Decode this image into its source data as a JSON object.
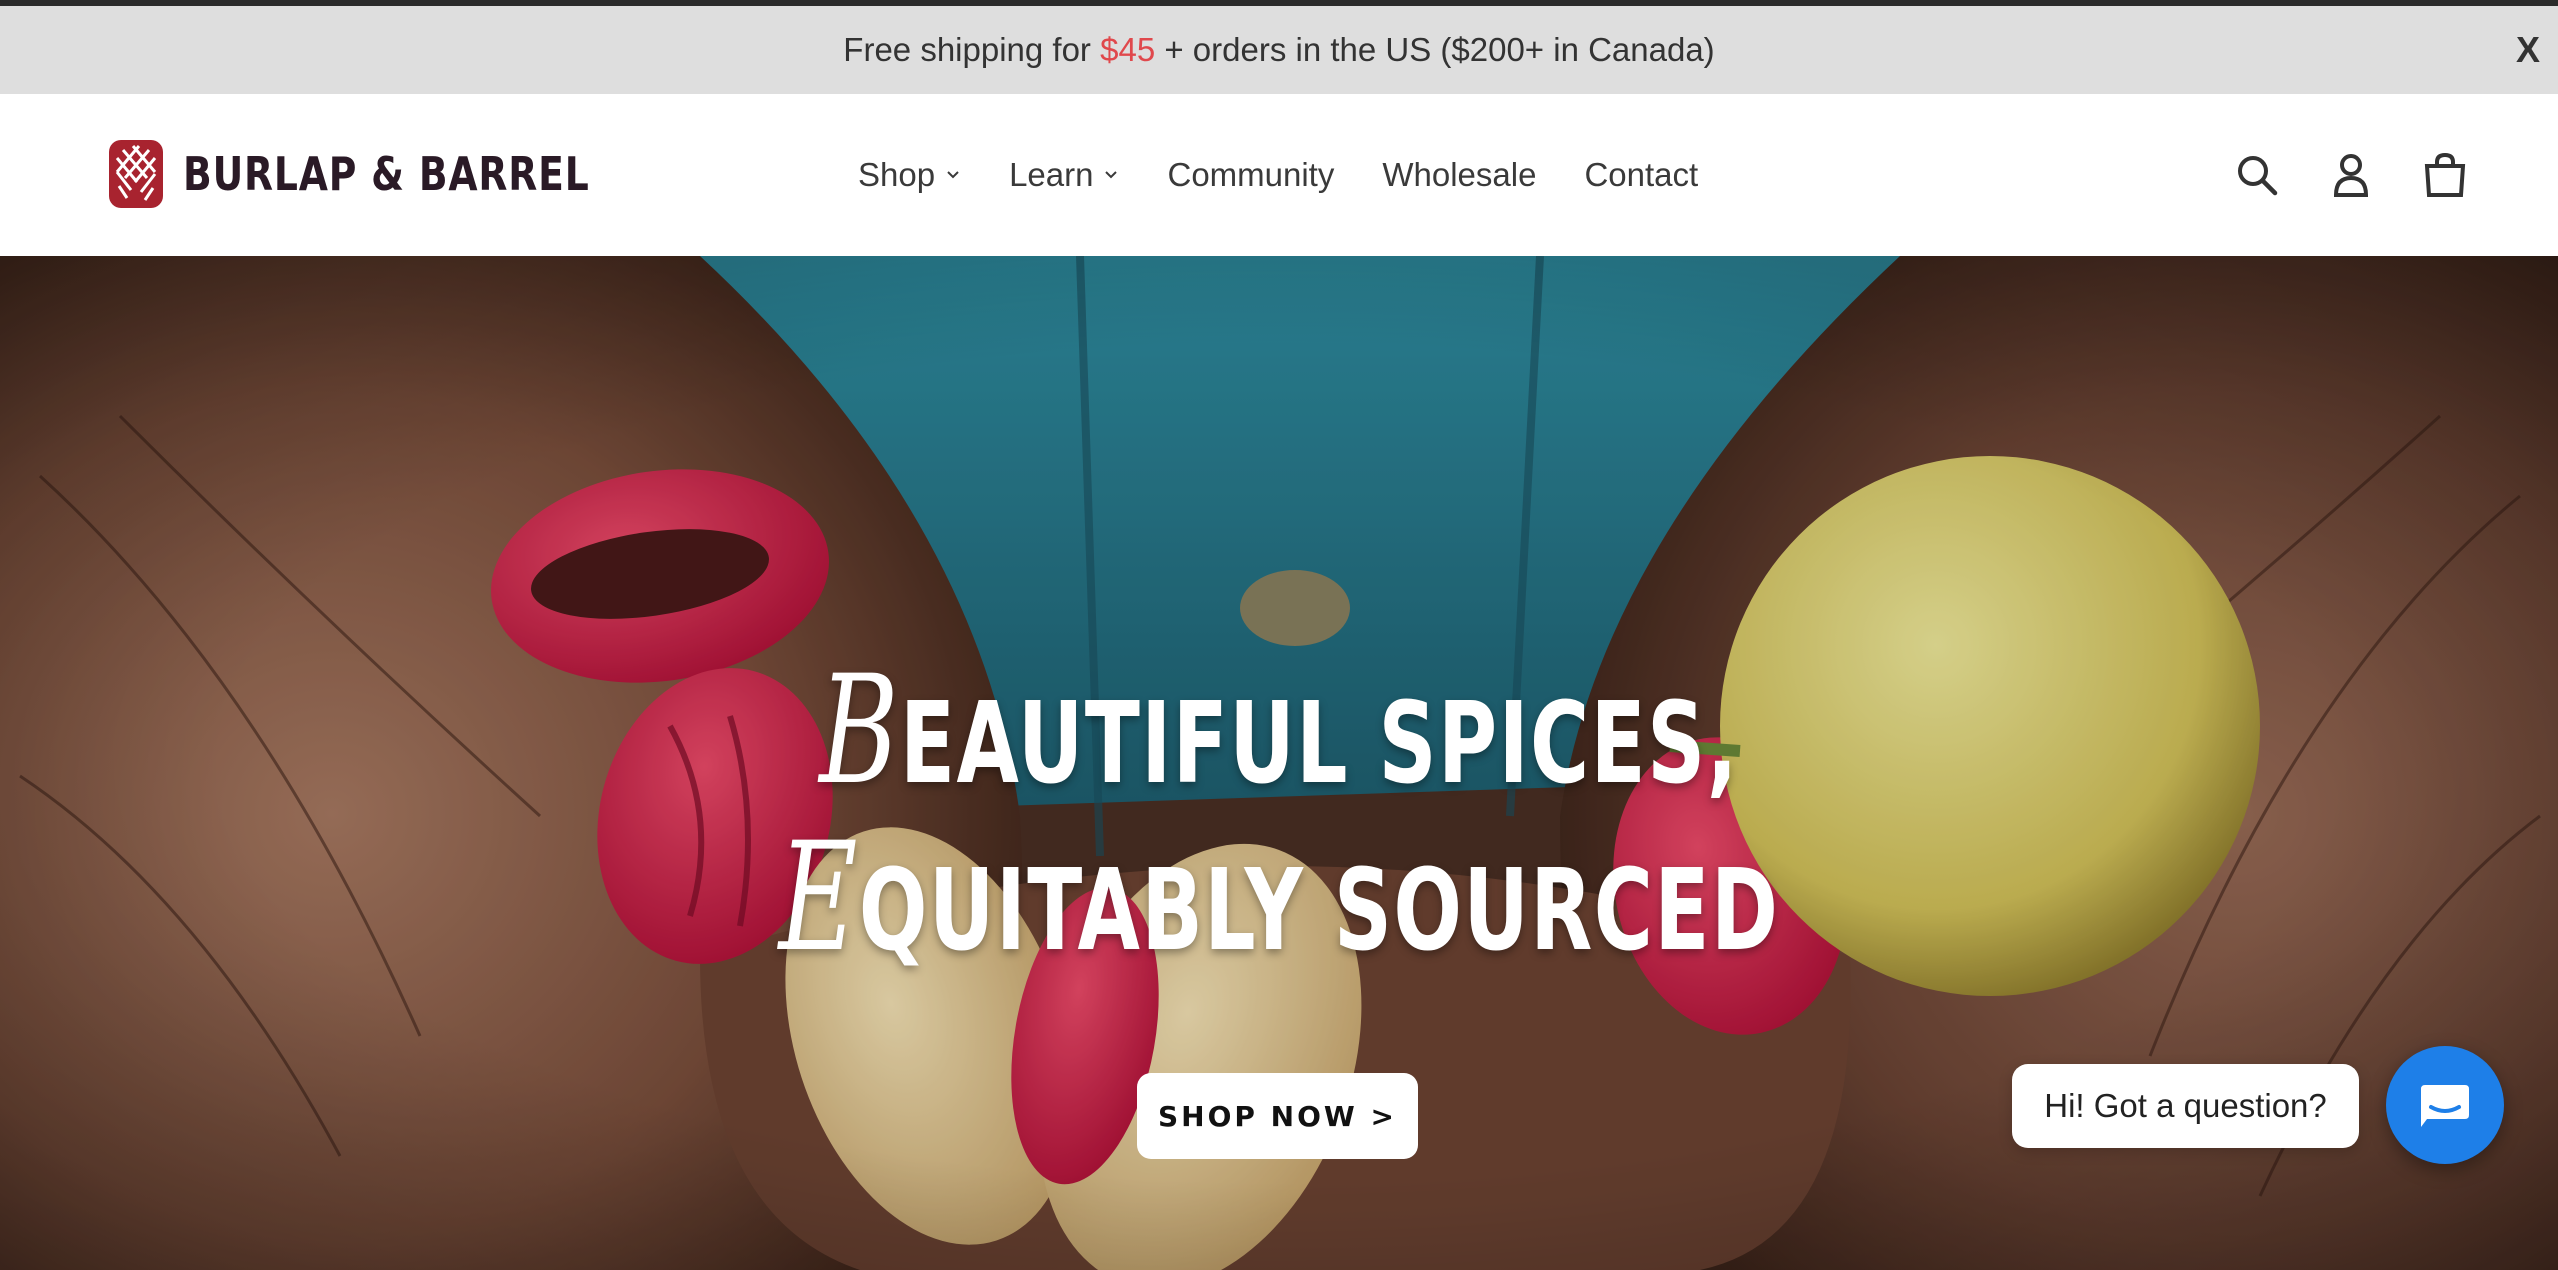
{
  "announcement": {
    "text_before": "Free shipping for ",
    "price": "$45",
    "text_after": " + orders in the US ($200+ in Canada)",
    "close_label": "X"
  },
  "brand": {
    "name": "BURLAP & BARREL",
    "color": "#a8232f"
  },
  "nav": {
    "items": [
      {
        "label": "Shop",
        "has_dropdown": true
      },
      {
        "label": "Learn",
        "has_dropdown": true
      },
      {
        "label": "Community",
        "has_dropdown": false
      },
      {
        "label": "Wholesale",
        "has_dropdown": false
      },
      {
        "label": "Contact",
        "has_dropdown": false
      }
    ]
  },
  "header_icons": [
    "search-icon",
    "account-icon",
    "cart-icon"
  ],
  "hero": {
    "headline_line1_cap": "B",
    "headline_line1_rest": "EAUTIFUL SPICES,",
    "headline_line2_cap": "E",
    "headline_line2_rest": "QUITABLY SOURCED",
    "cta_label": "SHOP NOW >"
  },
  "chat": {
    "prompt": "Hi! Got a question?",
    "button_color": "#1e7fe8"
  }
}
